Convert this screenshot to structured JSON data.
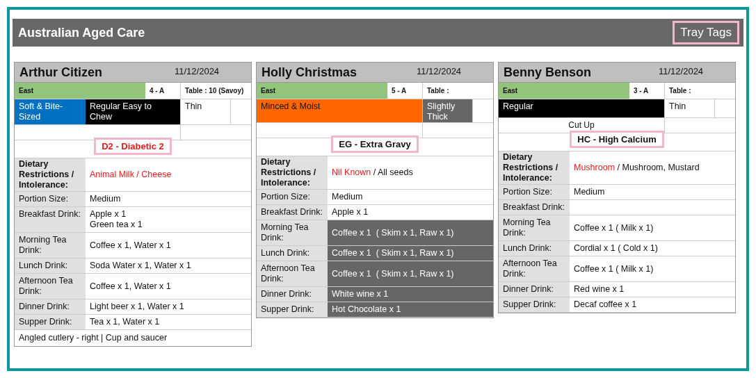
{
  "header": {
    "title": "Australian Aged Care",
    "button": "Tray Tags"
  },
  "cards": [
    {
      "name": "Arthur Citizen",
      "date": "11/12/2024",
      "wing": "East",
      "room": "4 - A",
      "table": "Table : 10 (Savoy)",
      "textures": [
        {
          "text": "Soft & Bite-Sized",
          "color": "#0070c0"
        },
        {
          "text": "Regular Easy to Chew",
          "color": "#000000"
        }
      ],
      "fluid": {
        "text": "Thin",
        "color": "#ffffff"
      },
      "diet_code": {
        "text": "D2 - Diabetic 2",
        "color": "#e02020"
      },
      "restriction_label": "Dietary Restrictions / Intolerance:",
      "restriction_parts": [
        {
          "text": "Animal Milk / Cheese",
          "color": "#e02020"
        }
      ],
      "rows": [
        {
          "label": "Portion Size:",
          "value": [
            "Medium"
          ],
          "shaded": false
        },
        {
          "label": "Breakfast Drink:",
          "value": [
            "Apple x 1",
            "Green tea x 1"
          ],
          "shaded": false
        },
        {
          "label": "Morning Tea Drink:",
          "value": [
            "Coffee x 1, Water x 1"
          ],
          "shaded": false
        },
        {
          "label": "Lunch Drink:",
          "value": [
            "Soda Water x 1, Water x 1"
          ],
          "shaded": false
        },
        {
          "label": "Afternoon Tea Drink:",
          "value": [
            "Coffee x 1, Water x 1"
          ],
          "shaded": false
        },
        {
          "label": "Dinner Drink:",
          "value": [
            "Light beer x 1, Water x 1"
          ],
          "shaded": false
        },
        {
          "label": "Supper Drink:",
          "value": [
            "Tea x 1, Water x 1"
          ],
          "shaded": false
        }
      ],
      "note": "Angled cutlery - right | Cup and saucer"
    },
    {
      "name": "Holly Christmas",
      "date": "11/12/2024",
      "wing": "East",
      "room": "5 - A",
      "table": "Table :",
      "textures": [
        {
          "text": "Minced & Moist",
          "color": "#ff6600"
        }
      ],
      "fluid": {
        "text": "Slightly Thick",
        "color": "#666666"
      },
      "diet_code": {
        "text": "EG - Extra Gravy",
        "color": "#111111"
      },
      "restriction_label": "Dietary Restrictions / Intolerance:",
      "restriction_parts": [
        {
          "text": "Nil Known",
          "color": "#e02020"
        },
        {
          "text": " / All seeds",
          "color": "#111111"
        }
      ],
      "rows": [
        {
          "label": "Portion Size:",
          "value": [
            "Medium"
          ],
          "shaded": false
        },
        {
          "label": "Breakfast Drink:",
          "value": [
            "Apple x 1"
          ],
          "shaded": false
        },
        {
          "label": "Morning Tea Drink:",
          "value": [
            "Coffee x 1  ( Skim x 1, Raw x 1)"
          ],
          "shaded": true
        },
        {
          "label": "Lunch Drink:",
          "value": [
            "Coffee x 1  ( Skim x 1, Raw x 1)"
          ],
          "shaded": true
        },
        {
          "label": "Afternoon Tea Drink:",
          "value": [
            "Coffee x 1  ( Skim x 1, Raw x 1)"
          ],
          "shaded": true
        },
        {
          "label": "Dinner Drink:",
          "value": [
            "White wine x 1"
          ],
          "shaded": true
        },
        {
          "label": "Supper Drink:",
          "value": [
            "Hot Chocolate x 1"
          ],
          "shaded": true
        }
      ]
    },
    {
      "name": "Benny Benson",
      "date": "11/12/2024",
      "wing": "East",
      "room": "3 - A",
      "table": "Table :",
      "textures": [
        {
          "text": "Regular",
          "color": "#000000"
        }
      ],
      "fluid": {
        "text": "Thin",
        "color": "#ffffff"
      },
      "extra": "Cut Up",
      "diet_code": {
        "text": "HC - High Calcium",
        "color": "#111111"
      },
      "restriction_label": "Dietary Restrictions / Intolerance:",
      "restriction_parts": [
        {
          "text": "Mushroom",
          "color": "#e02020"
        },
        {
          "text": " / Mushroom, Mustard",
          "color": "#111111"
        }
      ],
      "rows": [
        {
          "label": "Portion Size:",
          "value": [
            "Medium"
          ],
          "shaded": false
        },
        {
          "label": "Breakfast Drink:",
          "shaded": false
        },
        {
          "label": "Morning Tea Drink:",
          "value": [
            "Coffee x 1 ( Milk x 1)"
          ],
          "shaded": false
        },
        {
          "label": "Lunch Drink:",
          "value": [
            "Cordial x 1 ( Cold x 1)"
          ],
          "shaded": false
        },
        {
          "label": "Afternoon Tea Drink:",
          "value": [
            "Coffee x 1 ( Milk x 1)"
          ],
          "shaded": false
        },
        {
          "label": "Dinner Drink:",
          "value": [
            "Red wine x 1"
          ],
          "shaded": false
        },
        {
          "label": "Supper Drink:",
          "value": [
            "Decaf coffee x 1"
          ],
          "shaded": false
        }
      ]
    }
  ]
}
